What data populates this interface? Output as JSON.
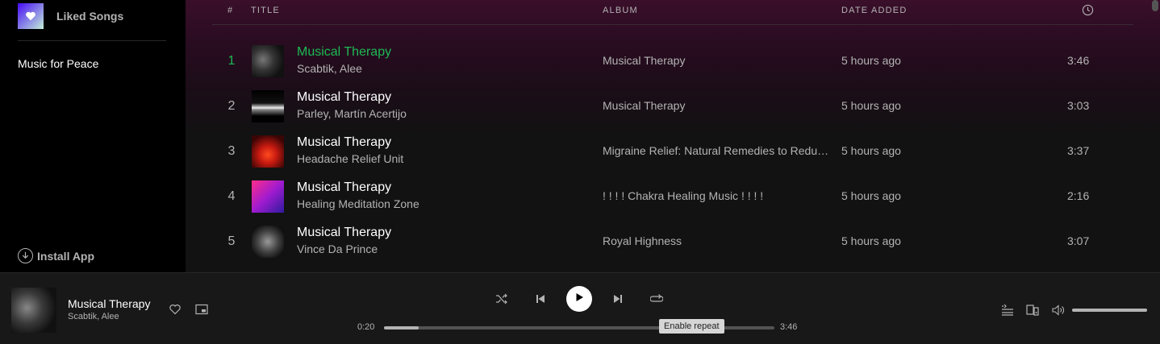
{
  "sidebar": {
    "liked_songs_label": "Liked Songs",
    "playlists": [
      "Music for Peace"
    ],
    "install_app_label": "Install App"
  },
  "tracklist": {
    "headers": {
      "num": "#",
      "title": "TITLE",
      "album": "ALBUM",
      "date_added": "DATE ADDED",
      "duration_icon": "clock-icon"
    },
    "rows": [
      {
        "num": "1",
        "title": "Musical Therapy",
        "artist": "Scabtik, Alee",
        "album": "Musical Therapy",
        "date_added": "5 hours ago",
        "duration": "3:46",
        "playing": true
      },
      {
        "num": "2",
        "title": "Musical Therapy",
        "artist": "Parley, Martín Acertijo",
        "album": "Musical Therapy",
        "date_added": "5 hours ago",
        "duration": "3:03",
        "playing": false
      },
      {
        "num": "3",
        "title": "Musical Therapy",
        "artist": "Headache Relief Unit",
        "album": "Migraine Relief: Natural Remedies to Reduce Headache and Stress",
        "date_added": "5 hours ago",
        "duration": "3:37",
        "playing": false
      },
      {
        "num": "4",
        "title": "Musical Therapy",
        "artist": "Healing Meditation Zone",
        "album": "! ! ! ! Chakra Healing Music ! ! ! !",
        "date_added": "5 hours ago",
        "duration": "2:16",
        "playing": false
      },
      {
        "num": "5",
        "title": "Musical Therapy",
        "artist": "Vince Da Prince",
        "album": "Royal Highness",
        "date_added": "5 hours ago",
        "duration": "3:07",
        "playing": false
      }
    ]
  },
  "player": {
    "now_playing_title": "Musical Therapy",
    "now_playing_artist": "Scabtik, Alee",
    "elapsed": "0:20",
    "total": "3:46",
    "progress_fraction": 0.088,
    "volume_fraction": 1.0,
    "tooltip": "Enable repeat"
  },
  "colors": {
    "accent": "#1db954",
    "background": "#121212",
    "sidebar": "#000000",
    "player_bar": "#181818"
  }
}
